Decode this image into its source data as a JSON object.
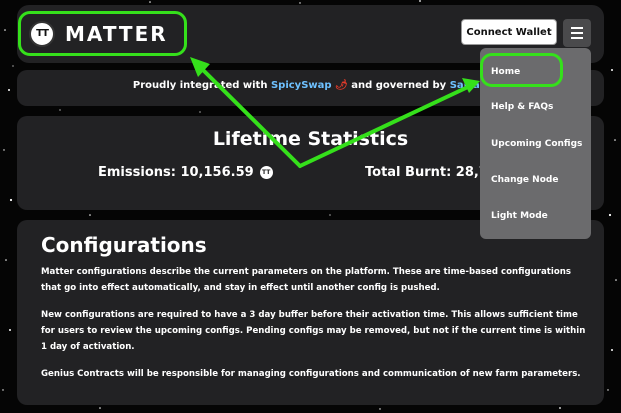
{
  "header": {
    "logo_badge": "TT",
    "logo_text": "MATTER",
    "connect_wallet_label": "Connect Wallet",
    "menu_icon": "hamburger-menu-icon"
  },
  "banner": {
    "prefix": "Proudly integrated with ",
    "spicy_link": "SpicySwap",
    "pepper": "🌶",
    "middle": " and governed by ",
    "salsa_link": "SalsaD"
  },
  "stats": {
    "title": "Lifetime Statistics",
    "emissions_label": "Emissions: 10,156.59",
    "burnt_label": "Total Burnt: 28,76",
    "token_badge": "TT"
  },
  "configurations": {
    "title": "Configurations",
    "paragraph1": "Matter configurations describe the current parameters on the platform. These are time-based configurations that go into effect automatically, and stay in effect until another config is pushed.",
    "paragraph2": "New configurations are required to have a 3 day buffer before their activation time. This allows sufficient time for users to review the upcoming configs. Pending configs may be removed, but not if the current time is within 1 day of activation.",
    "paragraph3": "Genius Contracts will be responsible for managing configurations and communication of new farm parameters."
  },
  "dropdown": {
    "items": [
      "Home",
      "Help & FAQs",
      "Upcoming Configs",
      "Change Node",
      "Light Mode"
    ]
  },
  "colors": {
    "highlight": "#35e01b",
    "link": "#6ec1ff",
    "card": "#222224",
    "dropdown": "#6b6b6d"
  }
}
